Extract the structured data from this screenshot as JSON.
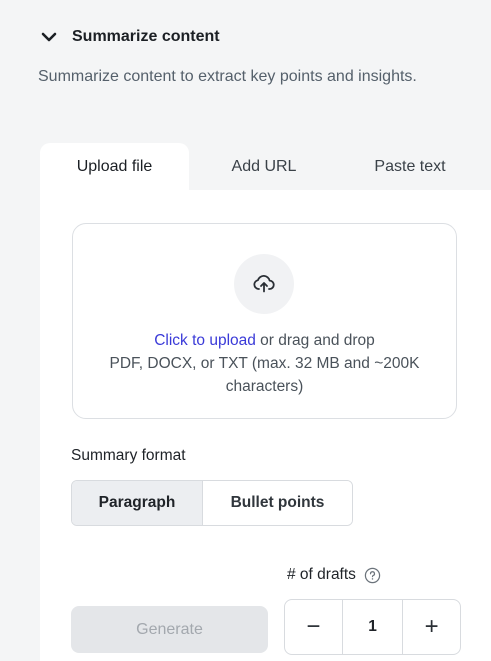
{
  "section": {
    "title": "Summarize content",
    "description": "Summarize content to extract key points and insights."
  },
  "tabs": [
    {
      "label": "Upload file",
      "active": true
    },
    {
      "label": "Add URL",
      "active": false
    },
    {
      "label": "Paste text",
      "active": false
    }
  ],
  "upload": {
    "link_text": "Click to upload",
    "rest_text": " or drag and drop",
    "hint": "PDF, DOCX, or TXT (max. 32 MB and ~200K characters)",
    "icon": "cloud-upload-icon"
  },
  "summary_format": {
    "label": "Summary format",
    "options": [
      "Paragraph",
      "Bullet points"
    ],
    "selected": "Paragraph"
  },
  "drafts": {
    "label": "# of drafts",
    "value": "1",
    "decrement": "−",
    "increment": "+"
  },
  "generate": {
    "label": "Generate",
    "disabled": true
  }
}
